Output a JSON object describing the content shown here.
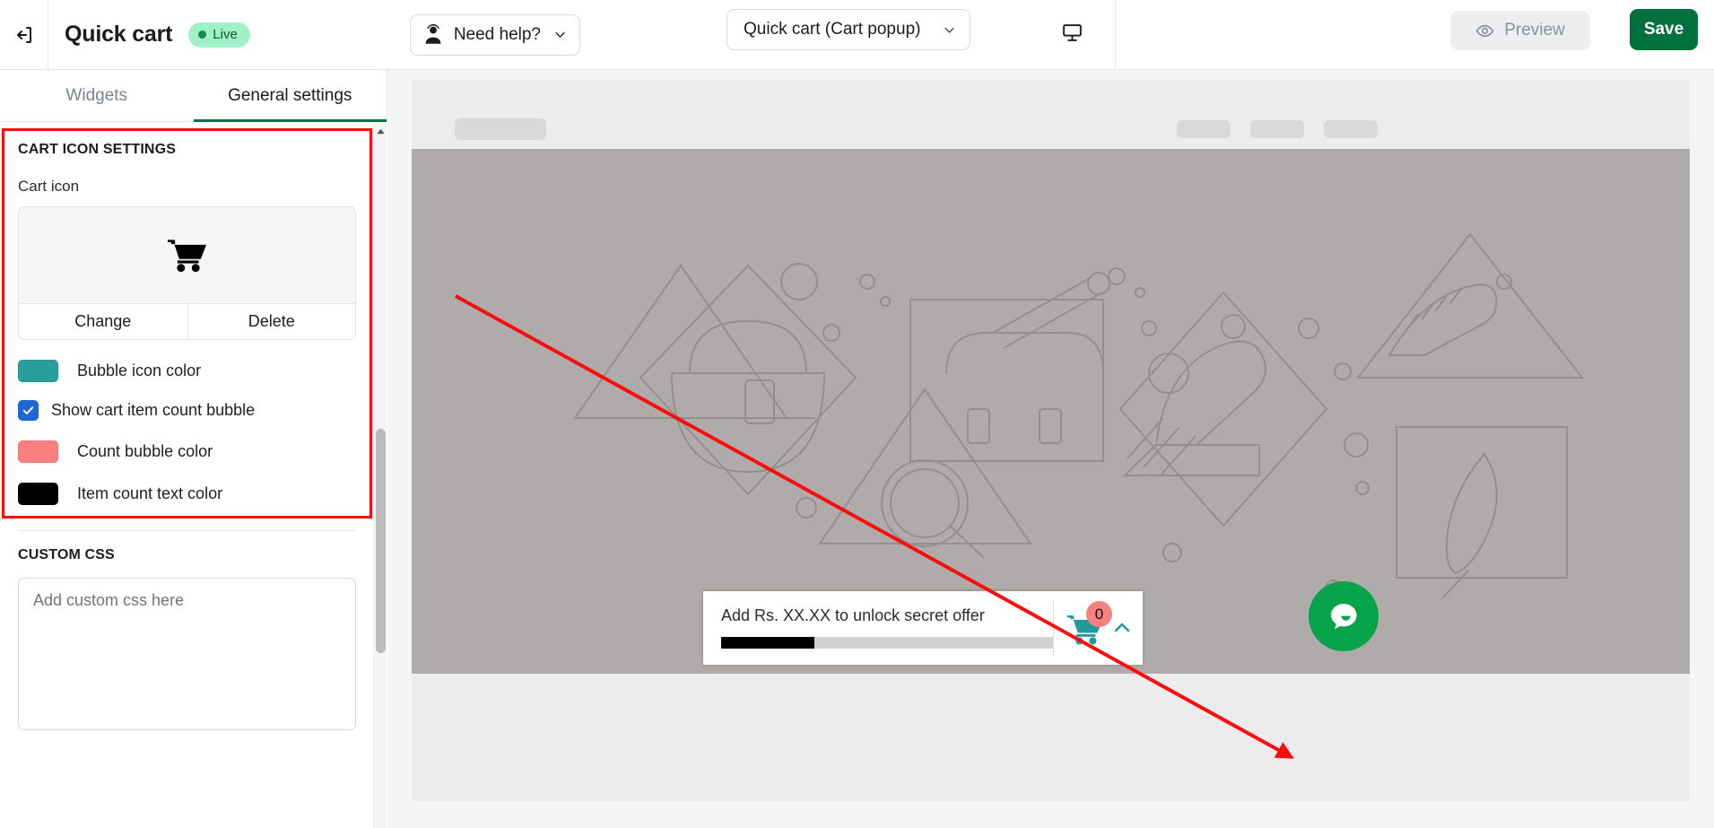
{
  "topbar": {
    "back_icon": "exit-icon",
    "app_title": "Quick cart",
    "status_badge": "Live",
    "help_label": "Need help?",
    "help_icon": "support-agent-icon",
    "view_selector_value": "Quick cart (Cart popup)",
    "device_icon": "desktop-icon",
    "preview_label": "Preview",
    "preview_icon": "eye-icon",
    "save_label": "Save"
  },
  "tabs": [
    {
      "label": "Widgets",
      "active": false
    },
    {
      "label": "General settings",
      "active": true
    }
  ],
  "settings": {
    "section_title": "CART ICON SETTINGS",
    "cart_icon_label": "Cart icon",
    "cart_icon_glyph": "shopping-cart-icon",
    "change_label": "Change",
    "delete_label": "Delete",
    "rows": [
      {
        "type": "color",
        "label": "Bubble icon color",
        "value": "#2a9d9d"
      },
      {
        "type": "checkbox",
        "label": "Show cart item count bubble",
        "checked": true,
        "value": "#2066d1"
      },
      {
        "type": "color",
        "label": "Count bubble color",
        "value": "#fa8080"
      },
      {
        "type": "color",
        "label": "Item count text color",
        "value": "#000000"
      }
    ],
    "custom_css_title": "CUSTOM CSS",
    "custom_css_placeholder": "Add custom css here",
    "custom_css_value": ""
  },
  "preview": {
    "cart_bar": {
      "message": "Add Rs. XX.XX to unlock secret offer",
      "progress_percent": 28,
      "progress_fill_color": "#000000",
      "progress_track_color": "#d2d2d2",
      "cart_icon": "shopping-cart-icon",
      "cart_icon_color": "#1f9a9a",
      "count_value": "0",
      "count_bubble_color": "#f98080",
      "count_text_color": "#111111",
      "caret_icon": "chevron-up-icon"
    },
    "chat_widget_icon": "chat-bubble-icon",
    "chat_widget_color": "#07a34a"
  },
  "annotation": {
    "highlight_color": "#fc0d0d"
  }
}
